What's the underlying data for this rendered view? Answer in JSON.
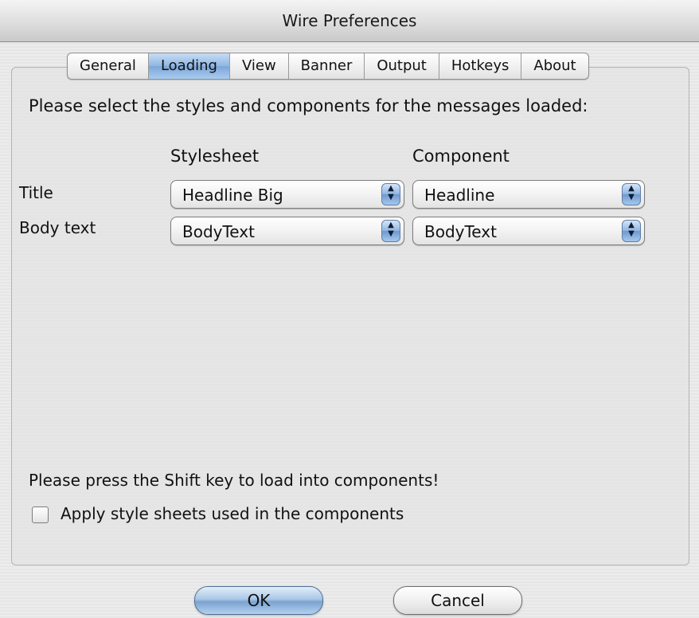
{
  "window": {
    "title": "Wire Preferences"
  },
  "tabs": [
    {
      "label": "General",
      "active": false
    },
    {
      "label": "Loading",
      "active": true
    },
    {
      "label": "View",
      "active": false
    },
    {
      "label": "Banner",
      "active": false
    },
    {
      "label": "Output",
      "active": false
    },
    {
      "label": "Hotkeys",
      "active": false
    },
    {
      "label": "About",
      "active": false
    }
  ],
  "content": {
    "intro": "Please select the styles and components for the messages loaded:",
    "columns": {
      "stylesheet": "Stylesheet",
      "component": "Component"
    },
    "rows": [
      {
        "label": "Title",
        "stylesheet": "Headline Big",
        "component": "Headline"
      },
      {
        "label": "Body text",
        "stylesheet": "BodyText",
        "component": "BodyText"
      }
    ],
    "note": "Please press the Shift key to load into components!",
    "checkbox": {
      "label": "Apply style sheets used in the components",
      "checked": false
    }
  },
  "buttons": {
    "ok": "OK",
    "cancel": "Cancel"
  },
  "colors": {
    "accent": "#7ca6d8",
    "window_bg": "#ececec"
  }
}
